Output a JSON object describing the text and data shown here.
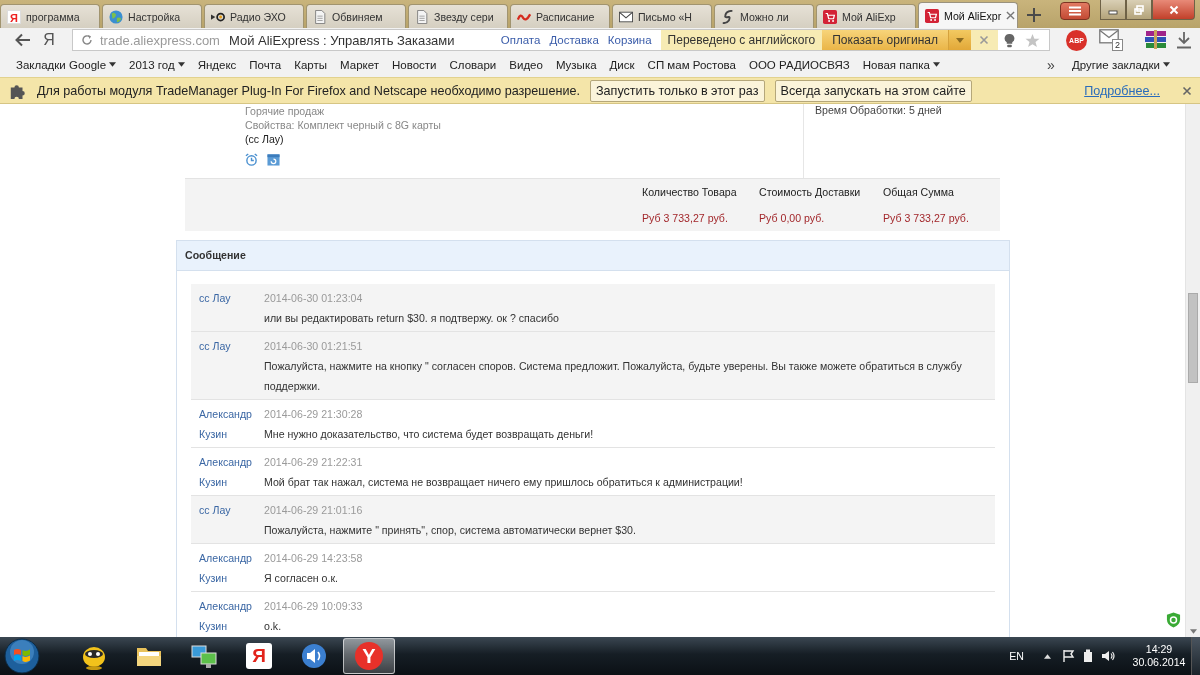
{
  "tabs": [
    {
      "title": "программа",
      "kind": "yandex",
      "glyph": "Я",
      "selected": false
    },
    {
      "title": "Настройка",
      "kind": "globe",
      "selected": false
    },
    {
      "title": "Радио ЭХО",
      "kind": "radio",
      "selected": false
    },
    {
      "title": "Обвиняем",
      "kind": "page",
      "selected": false
    },
    {
      "title": "Звезду сери",
      "kind": "page",
      "selected": false
    },
    {
      "title": "Расписание",
      "kind": "rail",
      "selected": false
    },
    {
      "title": "Письмо «Н",
      "kind": "mail",
      "selected": false
    },
    {
      "title": "Можно ли",
      "kind": "swirl",
      "selected": false
    },
    {
      "title": "Мой AliExp",
      "kind": "cart",
      "selected": false
    },
    {
      "title": "Мой AliExpr",
      "kind": "cart",
      "selected": true
    }
  ],
  "toolbar": {
    "yandex_button": "Я",
    "address": {
      "domain": "trade.aliexpress.com",
      "title": "Мой AliExpress : Управлять Заказами"
    },
    "links": [
      "Оплата",
      "Доставка",
      "Корзина"
    ],
    "translation": {
      "status": "Переведено с английского",
      "action": "Показать оригинал"
    },
    "extensions": [
      {
        "kind": "abp",
        "label": "ABP"
      },
      {
        "kind": "mail",
        "badge": "2"
      },
      {
        "kind": "archive"
      },
      {
        "kind": "download"
      }
    ]
  },
  "bookmarks": {
    "items": [
      {
        "label": "Закладки Google",
        "folder": true
      },
      {
        "label": "2013 год",
        "folder": true
      },
      {
        "label": "Яндекс",
        "folder": false
      },
      {
        "label": "Почта",
        "folder": false
      },
      {
        "label": "Карты",
        "folder": false
      },
      {
        "label": "Маркет",
        "folder": false
      },
      {
        "label": "Новости",
        "folder": false
      },
      {
        "label": "Словари",
        "folder": false
      },
      {
        "label": "Видео",
        "folder": false
      },
      {
        "label": "Музыка",
        "folder": false
      },
      {
        "label": "Диск",
        "folder": false
      },
      {
        "label": "СП мам Ростова",
        "folder": false
      },
      {
        "label": "ООО РАДИОСВЯЗ",
        "folder": false
      },
      {
        "label": "Новая папка",
        "folder": true
      }
    ],
    "overflow": "»",
    "other": {
      "label": "Другие закладки",
      "folder": true
    }
  },
  "infobar": {
    "message": "Для работы модуля TradeManager Plug-In For Firefox and Netscape необходимо разрешение.",
    "buttons": [
      "Запустить только в этот раз",
      "Всегда запускать на этом сайте"
    ],
    "link": "Подробнее..."
  },
  "order": {
    "item_lines": [
      {
        "kind": "muted",
        "text": "Горячие продаж"
      },
      {
        "kind": "muted",
        "text": "Свойства: Комплект черный с 8G карты"
      },
      {
        "kind": "plain",
        "text": "(сс Лау)"
      }
    ],
    "processing": "Время Обработки: 5 дней",
    "summary": [
      {
        "label": "Количество Товара",
        "value": "Руб 3 733,27 руб."
      },
      {
        "label": "Стоимость Доставки",
        "value": "Руб 0,00 руб."
      },
      {
        "label": "Общая Сумма",
        "value": "Руб 3 733,27 руб."
      }
    ]
  },
  "messages": {
    "title": "Сообщение",
    "items": [
      {
        "kind": "seller",
        "author": "сс Лау",
        "time": "2014-06-30 01:23:04",
        "text": "или вы редактировать return $30. я подтвержу. ок ? спасибо"
      },
      {
        "kind": "seller",
        "author": "сс Лау",
        "time": "2014-06-30 01:21:51",
        "text": "Пожалуйста, нажмите на кнопку \" согласен споров. Система предложит. Пожалуйста, будьте уверены. Вы также можете обратиться в службу поддержки."
      },
      {
        "kind": "buyer",
        "author": "Александр Кузин",
        "time": "2014-06-29 21:30:28",
        "text": "Мне нужно доказательство, что система будет возвращать деньги!"
      },
      {
        "kind": "buyer",
        "author": "Александр Кузин",
        "time": "2014-06-29 21:22:31",
        "text": "Мой брат так нажал, система не возвращает ничего ему пришлось обратиться к администрации!"
      },
      {
        "kind": "seller",
        "author": "сс Лау",
        "time": "2014-06-29 21:01:16",
        "text": "Пожалуйста, нажмите \" принять\", спор, система автоматически вернет $30."
      },
      {
        "kind": "buyer",
        "author": "Александр Кузин",
        "time": "2014-06-29 14:23:58",
        "text": "Я согласен о.к."
      },
      {
        "kind": "buyer",
        "author": "Александр Кузин",
        "time": "2014-06-29 10:09:33",
        "text": "o.k."
      }
    ]
  },
  "taskbar": {
    "apps": [
      {
        "kind": "mascot",
        "selected": false
      },
      {
        "kind": "folder",
        "selected": false
      },
      {
        "kind": "monitors",
        "selected": false
      },
      {
        "kind": "yandex",
        "glyph": "Я",
        "selected": false
      },
      {
        "kind": "speaker",
        "selected": false
      },
      {
        "kind": "browser",
        "glyph": "Y",
        "selected": true
      }
    ],
    "language": "EN",
    "time": "14:29",
    "date": "30.06.2014"
  }
}
